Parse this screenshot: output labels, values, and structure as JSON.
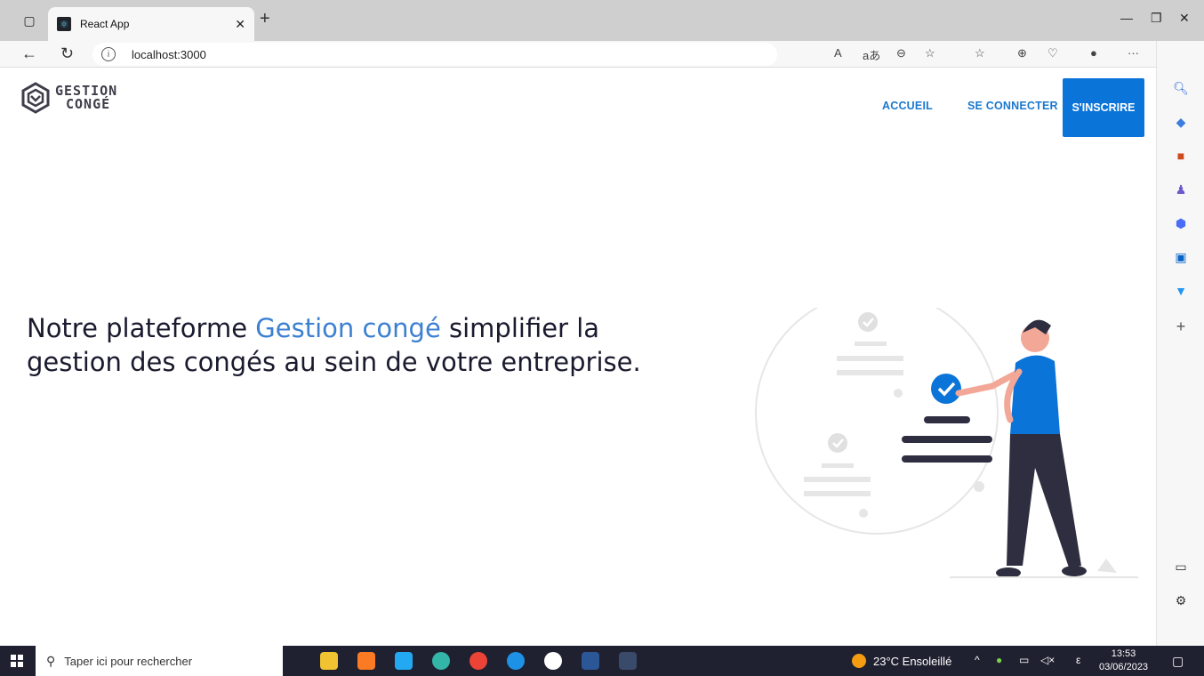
{
  "browser": {
    "tab_title": "React App",
    "url": "localhost:3000",
    "new_tab_icon": "plus-icon"
  },
  "nav": {
    "logo_line1": "GESTION",
    "logo_line2": "CONGÉ",
    "home": "ACCUEIL",
    "login": "SE CONNECTER",
    "signup": "S'INSCRIRE"
  },
  "hero": {
    "text_before": "Notre plateforme ",
    "accent": "Gestion congé",
    "text_after": " simplifier la gestion des congés au sein de votre entreprise."
  },
  "taskbar": {
    "search_placeholder": "Taper ici pour rechercher",
    "weather": "23°C  Ensoleillé",
    "time": "13:53",
    "date": "03/06/2023"
  },
  "colors": {
    "accent": "#3c80d1",
    "button": "#0b74d8"
  }
}
